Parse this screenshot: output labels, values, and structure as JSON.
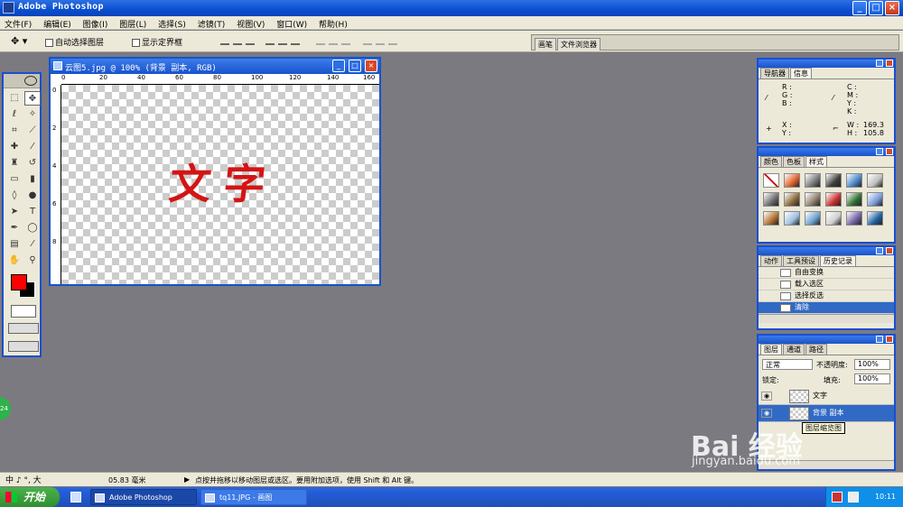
{
  "app": {
    "title": "Adobe Photoshop"
  },
  "window_controls": {
    "minimize": "_",
    "maximize": "□",
    "close": "×"
  },
  "menu": [
    "文件(F)",
    "编辑(E)",
    "图像(I)",
    "图层(L)",
    "选择(S)",
    "滤镜(T)",
    "视图(V)",
    "窗口(W)",
    "帮助(H)"
  ],
  "options": {
    "auto_select": "自动选择图层",
    "show_bounds": "显示定界框",
    "tab_brush": "画笔",
    "tab_file_browser": "文件浏览器"
  },
  "document": {
    "title": "云图5.jpg @ 100% (背景 副本, RGB)",
    "canvas_text": "文字",
    "ruler_h": [
      "0",
      "20",
      "40",
      "60",
      "80",
      "100",
      "120",
      "140",
      "160"
    ],
    "ruler_v": [
      "0",
      "2",
      "4",
      "6",
      "8"
    ]
  },
  "navigator": {
    "tabs": [
      "导航器",
      "信息"
    ],
    "labels": {
      "r": "R :",
      "g": "G :",
      "b": "B :",
      "c": "C :",
      "m": "M :",
      "y": "Y :",
      "k": "K :",
      "x": "X :",
      "yy": "Y :",
      "w": "W :",
      "h": "H :"
    },
    "w_value": "169.3",
    "h_value": "105.8"
  },
  "styles": {
    "tabs": [
      "颜色",
      "色板",
      "样式"
    ],
    "swatches": [
      "#ffffff",
      "#e0622b",
      "#7a7a7a",
      "#3d3d3d",
      "#4a86c8",
      "#bfbfbf",
      "#6e6e6e",
      "#8a6a3a",
      "#8f7f6f",
      "#c72f2f",
      "#2f6f2f",
      "#7a9ad8",
      "#b07030",
      "#9fc0e0",
      "#6fa0d0",
      "#d0d0d0",
      "#7060a0",
      "#2060a0"
    ]
  },
  "history": {
    "tabs": [
      "动作",
      "工具预设",
      "历史记录"
    ],
    "items": [
      "自由变换",
      "载入选区",
      "选择反选",
      "清除"
    ]
  },
  "layers": {
    "tabs": [
      "图层",
      "通道",
      "路径"
    ],
    "blend": "正常",
    "opacity_label": "不透明度:",
    "opacity": "100%",
    "lock_label": "锁定:",
    "fill_label": "填充:",
    "fill": "100%",
    "items": [
      "文字",
      "背景 副本"
    ],
    "tooltip": "图层缩览图"
  },
  "status": {
    "ime": "中 ♪ °, 大",
    "zoom": "05.83 毫米",
    "hint": "点按并拖移以移动图层或选区。要用附加选项，使用 Shift 和 Alt 键。"
  },
  "taskbar": {
    "start": "开始",
    "tasks": [
      "Adobe Photoshop",
      "tq11.JPG - 画图"
    ],
    "clock": "10:11"
  },
  "badge": "24",
  "watermark": {
    "brand": "Bai 经验",
    "url": "jingyan.baidu.com"
  }
}
